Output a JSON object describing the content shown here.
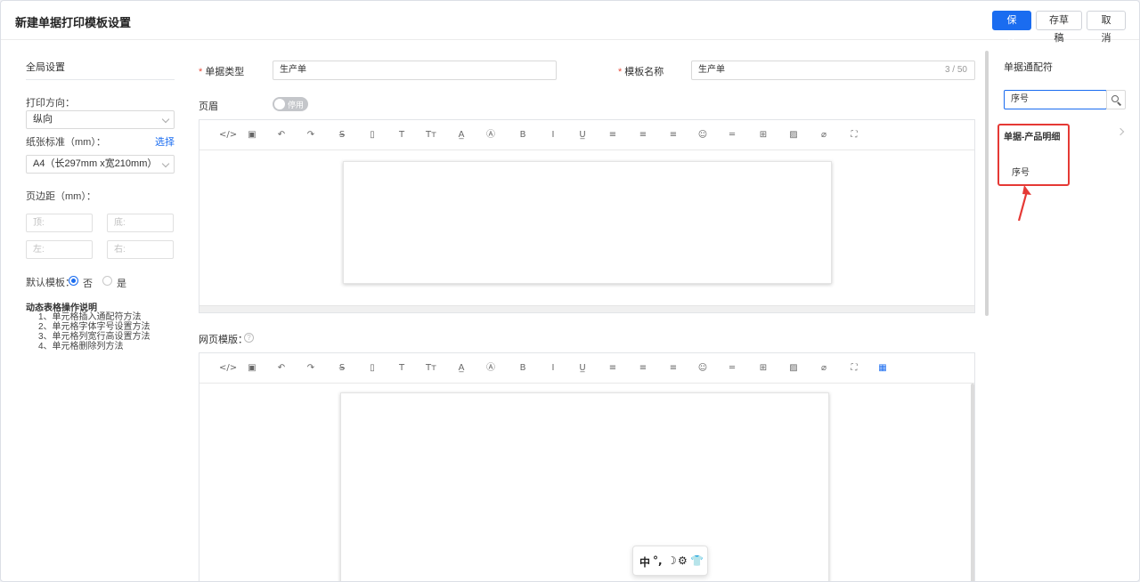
{
  "header": {
    "title": "新建单据打印模板设置",
    "save_label": "保 存",
    "draft_label": "存草稿",
    "cancel_label": "取 消"
  },
  "left_panel": {
    "section_title": "全局设置",
    "orientation_label": "打印方向：",
    "orientation_value": "纵向",
    "paper_label": "纸张标准（mm）：",
    "paper_choose": "选择",
    "paper_value": "A4（长297mm x宽210mm）",
    "margins_label": "页边距（mm）：",
    "margin_top_placeholder": "顶:",
    "margin_bottom_placeholder": "底:",
    "margin_left_placeholder": "左:",
    "margin_right_placeholder": "右:",
    "default_label": "默认模板：",
    "default_no": "否",
    "default_yes": "是",
    "default_selected": "否",
    "notes_title": "动态表格操作说明",
    "notes": [
      "1、单元格插入通配符方法",
      "2、单元格字体字号设置方法",
      "3、单元格列宽行高设置方法",
      "4、单元格删除列方法"
    ]
  },
  "center": {
    "doc_type_label": "单据类型",
    "doc_type_value": "生产单",
    "template_name_label": "模板名称",
    "template_name_value": "生产单",
    "template_name_counter": "3 / 50",
    "header_label": "页眉",
    "header_toggle_text": "停用",
    "web_template_label": "网页模版：",
    "help_glyph": "?"
  },
  "toolbar_icons": [
    {
      "name": "code-view-icon",
      "glyph": "</>"
    },
    {
      "name": "template-icon",
      "glyph": "▣"
    },
    {
      "name": "undo-icon",
      "glyph": "↶"
    },
    {
      "name": "redo-icon",
      "glyph": "↷"
    },
    {
      "name": "strikethrough-icon",
      "glyph": "S̶"
    },
    {
      "name": "document-icon",
      "glyph": "▯"
    },
    {
      "name": "font-size-icon",
      "glyph": "T"
    },
    {
      "name": "line-height-icon",
      "glyph": "Tт"
    },
    {
      "name": "font-color-icon",
      "glyph": "A̲"
    },
    {
      "name": "background-color-icon",
      "glyph": "Ⓐ"
    },
    {
      "name": "bold-icon",
      "glyph": "B"
    },
    {
      "name": "italic-icon",
      "glyph": "I"
    },
    {
      "name": "underline-icon",
      "glyph": "U̲"
    },
    {
      "name": "align-left-icon",
      "glyph": "≡"
    },
    {
      "name": "align-center-icon",
      "glyph": "≡"
    },
    {
      "name": "align-right-icon",
      "glyph": "≡"
    },
    {
      "name": "emoji-icon",
      "glyph": "☺"
    },
    {
      "name": "horizontal-rule-icon",
      "glyph": "═"
    },
    {
      "name": "table-icon",
      "glyph": "⊞"
    },
    {
      "name": "image-icon",
      "glyph": "▨"
    },
    {
      "name": "attachment-icon",
      "glyph": "⌀"
    },
    {
      "name": "fullscreen-icon",
      "glyph": "⛶"
    }
  ],
  "toolbar_extra_icon": {
    "name": "dynamic-table-icon",
    "glyph": "▦"
  },
  "right_panel": {
    "title": "单据通配符",
    "search_value": "序号",
    "group_label": "单据-产品明细",
    "item_label": "序号"
  },
  "float_bar": [
    "中",
    "°,",
    "☽",
    "⚙",
    "👕"
  ],
  "colors": {
    "primary": "#1a6cf0",
    "highlight": "#e53935"
  }
}
